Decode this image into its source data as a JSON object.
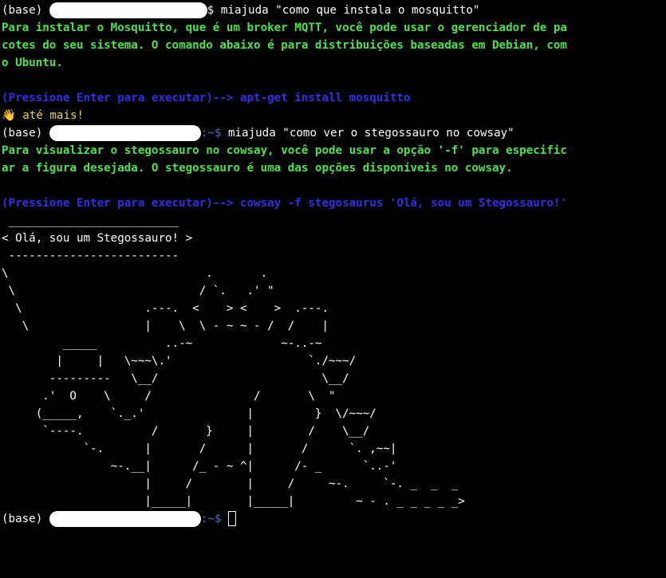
{
  "prompt": {
    "env": "(base) ",
    "suffix": ":~$ ",
    "suffix_short": "$ "
  },
  "commands": [
    "miajuda \"como que instala o mosquitto\"",
    "miajuda \"como ver o stegossauro no cowsay\""
  ],
  "output1": {
    "lines": [
      "Para instalar o Mosquitto, que é um broker MQTT, você pode usar o gerenciador de pa",
      "cotes do seu sistema. O comando abaixo é para distribuições baseadas em Debian, com",
      "o Ubuntu."
    ],
    "run_prompt": "(Pressione Enter para executar)--> apt-get install mosquitto",
    "bye": "👋 até mais!"
  },
  "output2": {
    "lines": [
      "Para visualizar o stegossauro no cowsay, você pode usar a opção '-f' para especific",
      "ar a figura desejada. O stegossauro é uma das opções disponíveis no cowsay."
    ],
    "run_prompt": "(Pressione Enter para executar)--> cowsay -f stegosaurus 'Olá, sou um Stegossauro!'"
  },
  "cowsay": [
    " _________________________",
    "< Olá, sou um Stegossauro! >",
    " -------------------------",
    "\\                             .       .",
    " \\                           / `.   .' \"",
    "  \\                  .---.  <    > <    >  .---.",
    "   \\                 |    \\  \\ - ~ ~ - /  /    |",
    "         _____          ..-~             ~-..-~",
    "        |     |   \\~~~\\.'                    `./~~~/",
    "       ---------   \\__/                        \\__/",
    "      .'  O    \\     /               /       \\  \"",
    "     (_____,    `._.'               |         }  \\/~~~/",
    "      `----.          /       }     |        /    \\__/",
    "            `-.      |       /      |       /      `. ,~~|",
    "                ~-.__|      /_ - ~ ^|      /- _      `..-'",
    "                     |     /        |     /     ~-.     `-. _  _  _",
    "                     |_____|        |_____|         ~ - . _ _ _ _ _>"
  ]
}
